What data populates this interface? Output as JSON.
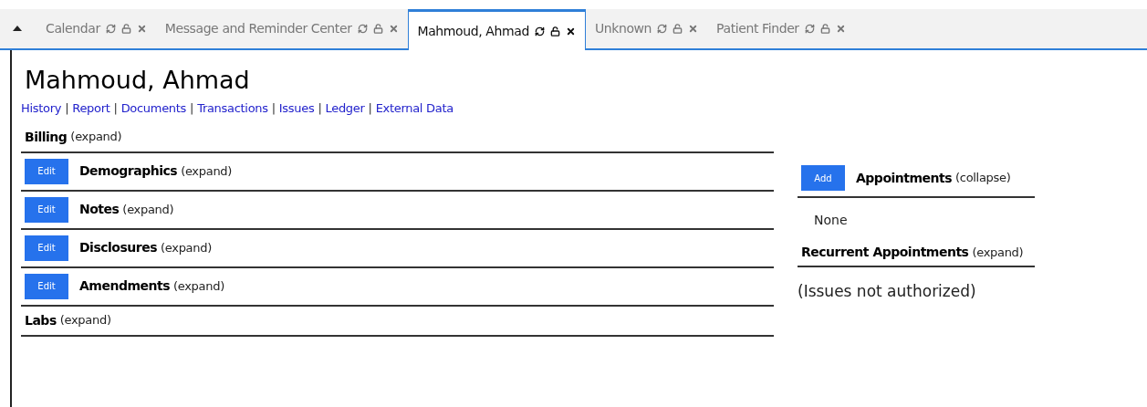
{
  "tabs": [
    {
      "label": "Calendar",
      "selected": false
    },
    {
      "label": "Message and Reminder Center",
      "selected": false
    },
    {
      "label": "Mahmoud, Ahmad",
      "selected": true
    },
    {
      "label": "Unknown",
      "selected": false
    },
    {
      "label": "Patient Finder",
      "selected": false
    }
  ],
  "patient_name": "Mahmoud, Ahmad",
  "nav_links": [
    {
      "kind": "link",
      "text": "History"
    },
    {
      "kind": "separator",
      "text": "|"
    },
    {
      "kind": "link",
      "text": "Report"
    },
    {
      "kind": "separator",
      "text": "|"
    },
    {
      "kind": "link",
      "text": "Documents"
    },
    {
      "kind": "separator",
      "text": "|"
    },
    {
      "kind": "link",
      "text": "Transactions"
    },
    {
      "kind": "separator",
      "text": "|"
    },
    {
      "kind": "link",
      "text": "Issues"
    },
    {
      "kind": "separator",
      "text": "|"
    },
    {
      "kind": "link",
      "text": "Ledger"
    },
    {
      "kind": "separator",
      "text": "|"
    },
    {
      "kind": "link",
      "text": "External Data"
    }
  ],
  "left_sections": [
    {
      "title": "Billing",
      "toggle": "(expand)"
    },
    {
      "button": "Edit",
      "title": "Demographics",
      "toggle": "(expand)"
    },
    {
      "button": "Edit",
      "title": "Notes",
      "toggle": "(expand)"
    },
    {
      "button": "Edit",
      "title": "Disclosures",
      "toggle": "(expand)"
    },
    {
      "button": "Edit",
      "title": "Amendments",
      "toggle": "(expand)"
    },
    {
      "title": "Labs",
      "toggle": "(expand)"
    }
  ],
  "appointments": {
    "button": "Add",
    "title": "Appointments",
    "toggle": "(collapse)",
    "body": "None"
  },
  "recurrent_appointments": {
    "title": "Recurrent Appointments",
    "toggle": "(expand)"
  },
  "issues_message": "(Issues not authorized)"
}
